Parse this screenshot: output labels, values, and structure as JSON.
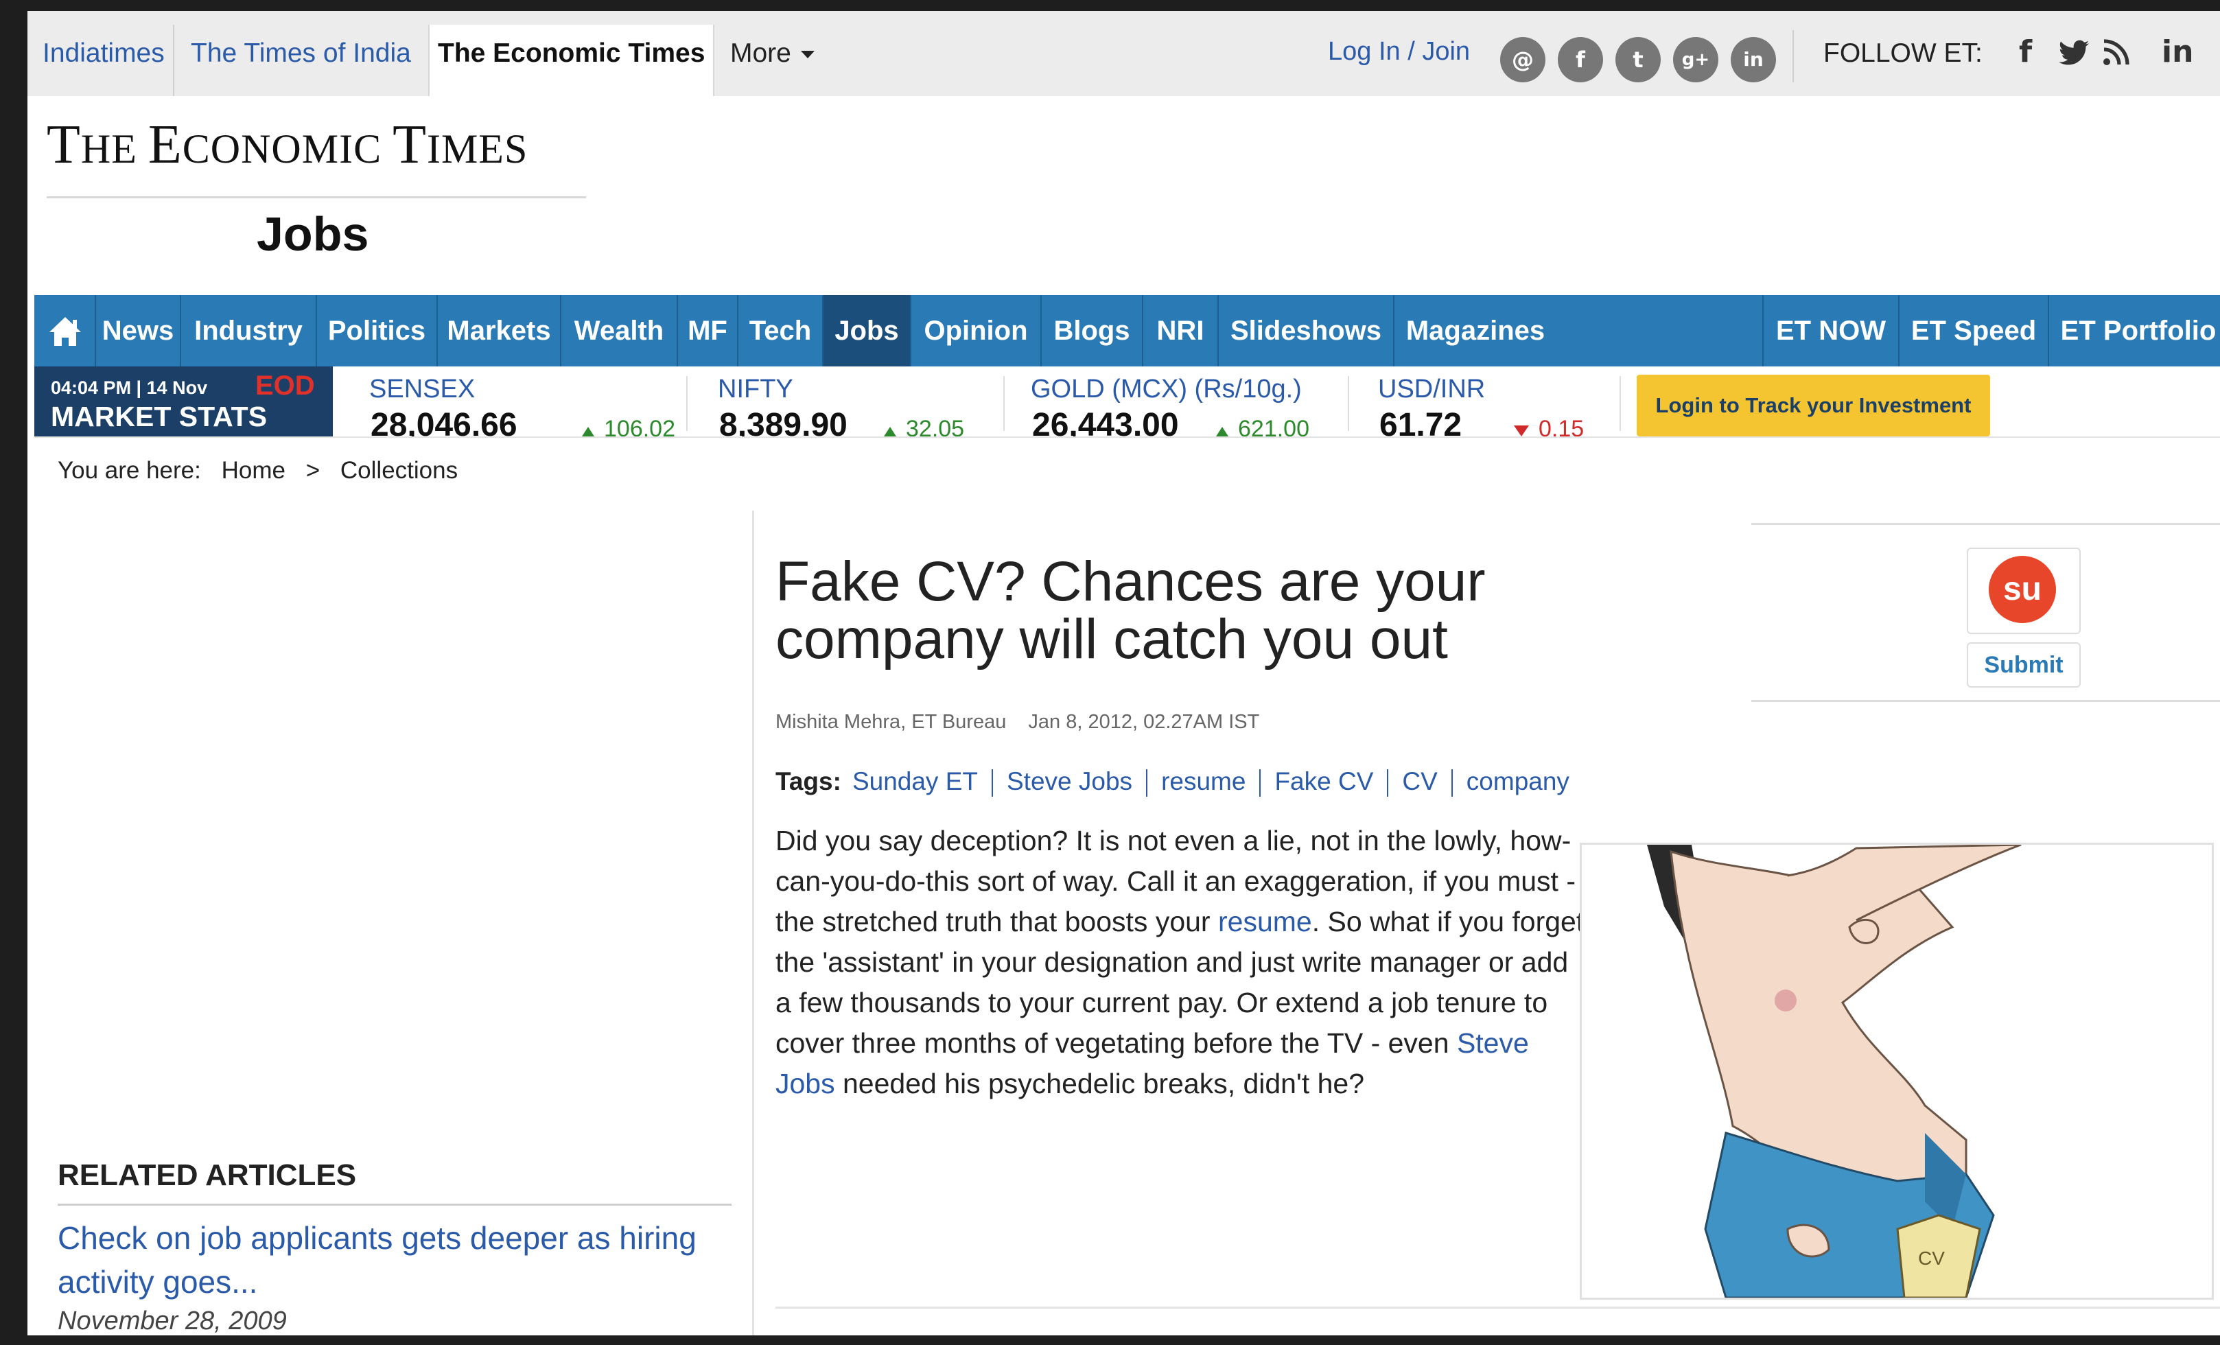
{
  "network_tabs": [
    "Indiatimes",
    "The Times of India",
    "The Economic Times",
    "More"
  ],
  "login_text": "Log In / Join",
  "social_icons": [
    "email-icon",
    "facebook-icon",
    "twitter-icon",
    "google-plus-icon",
    "linkedin-icon"
  ],
  "follow_label": "FOLLOW ET:",
  "follow_icons": [
    "facebook-icon",
    "twitter-icon",
    "rss-icon",
    "linkedin-icon"
  ],
  "logo": {
    "p1": "T",
    "p2": "HE ",
    "p3": "E",
    "p4": "CONOMIC ",
    "p5": "T",
    "p6": "IMES"
  },
  "section_title": "Jobs",
  "nav": [
    "News",
    "Industry",
    "Politics",
    "Markets",
    "Wealth",
    "MF",
    "Tech",
    "Jobs",
    "Opinion",
    "Blogs",
    "NRI",
    "Slideshows",
    "Magazines",
    "ET NOW",
    "ET Speed",
    "ET Portfolio"
  ],
  "nav_active": "Jobs",
  "market": {
    "time": "04:04 PM | 14 Nov",
    "eod": "EOD",
    "label": "MARKET STATS",
    "indices": [
      {
        "name": "SENSEX",
        "value": "28,046.66",
        "change": "106.02",
        "direction": "up"
      },
      {
        "name": "NIFTY",
        "value": "8,389.90",
        "change": "32.05",
        "direction": "up"
      },
      {
        "name": "GOLD (MCX) (Rs/10g.)",
        "value": "26,443.00",
        "change": "621.00",
        "direction": "up"
      },
      {
        "name": "USD/INR",
        "value": "61.72",
        "change": "0.15",
        "direction": "down"
      }
    ],
    "track_button": "Login to Track your Investment"
  },
  "breadcrumb": {
    "label": "You are here:",
    "items": [
      "Home",
      ">",
      "Collections"
    ]
  },
  "article": {
    "headline": "Fake CV? Chances are your company will catch you out",
    "author": "Mishita Mehra, ET Bureau",
    "date": "Jan 8, 2012, 02.27AM IST",
    "tags_label": "Tags:",
    "tags": [
      "Sunday ET",
      "Steve Jobs",
      "resume",
      "Fake CV",
      "CV",
      "company"
    ],
    "body_1": "Did you say deception? It is not even a lie, not in the lowly, how-can-you-do-this sort of way. Call it an exaggeration, if you must - the stretched truth that boosts your ",
    "body_link_1": "resume",
    "body_2": ". So what if you forget the 'assistant' in your designation and just write manager or add a few thousands to your current pay. Or extend a job tenure to cover three months of vegetating before the TV - even ",
    "body_link_2": "Steve Jobs",
    "body_3": " needed his psychedelic breaks, didn't he?"
  },
  "illustration_text": "CV",
  "share": {
    "icon": "stumbleupon-icon",
    "glyph": "su",
    "label": "Submit"
  },
  "related": {
    "title": "RELATED ARTICLES",
    "link": "Check on job applicants gets deeper as hiring activity goes...",
    "date": "November 28, 2009"
  },
  "colors": {
    "nav_bg": "#2a7ab6",
    "nav_active": "#1b4e7b",
    "market_label_bg": "#1b3f66",
    "link": "#2a5aa8",
    "track_button": "#f5c531"
  }
}
